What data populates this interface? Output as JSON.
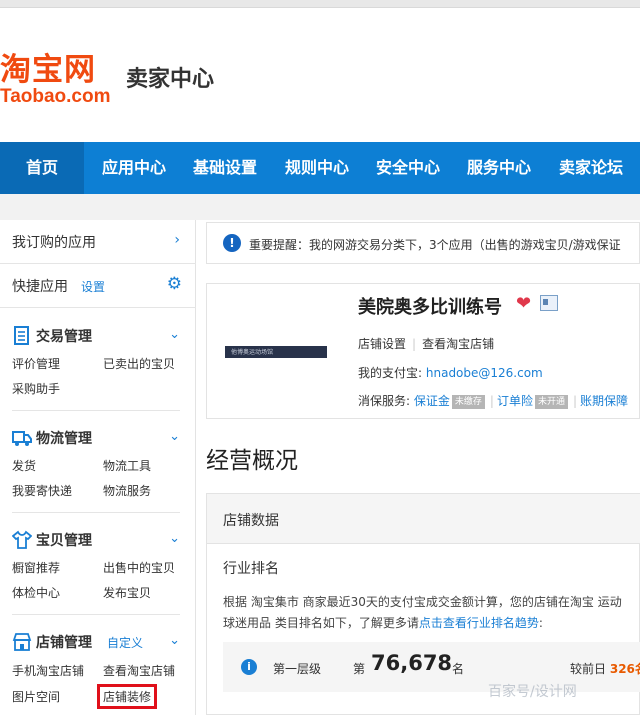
{
  "header": {
    "logo_cn": "淘宝网",
    "logo_en": "Taobao.com",
    "title": "卖家中心"
  },
  "nav": {
    "items": [
      {
        "label": "首页",
        "active": true
      },
      {
        "label": "应用中心"
      },
      {
        "label": "基础设置"
      },
      {
        "label": "规则中心"
      },
      {
        "label": "安全中心"
      },
      {
        "label": "服务中心"
      },
      {
        "label": "卖家论坛"
      }
    ]
  },
  "sidebar": {
    "subscribed": "我订购的应用",
    "quick": "快捷应用",
    "quick_setting": "设置",
    "sections": [
      {
        "title": "交易管理",
        "items": [
          "评价管理",
          "已卖出的宝贝",
          "采购助手"
        ]
      },
      {
        "title": "物流管理",
        "items": [
          "发货",
          "物流工具",
          "我要寄快递",
          "物流服务"
        ]
      },
      {
        "title": "宝贝管理",
        "items": [
          "橱窗推荐",
          "出售中的宝贝",
          "体检中心",
          "发布宝贝"
        ]
      },
      {
        "title": "店铺管理",
        "extra": "自定义",
        "items": [
          "手机淘宝店铺",
          "查看淘宝店铺",
          "图片空间",
          "店铺装修"
        ]
      }
    ]
  },
  "notice": {
    "text": "重要提醒：我的网游交易分类下，3个应用（出售的游戏宝贝/游戏保证"
  },
  "shop": {
    "thumb_text": "他博奥运动场馆",
    "name": "美院奥多比训练号",
    "links": [
      "店铺设置",
      "查看淘宝店铺"
    ],
    "alipay_label": "我的支付宝:",
    "alipay": "hnadobe@126.com",
    "insurance_label": "消保服务:",
    "insurance": [
      {
        "label": "保证金",
        "tag": "未缴存"
      },
      {
        "label": "订单险",
        "tag": "未开通"
      },
      {
        "label": "账期保障"
      }
    ]
  },
  "overview": {
    "title": "经营概况",
    "panel_title": "店铺数据",
    "rank_title": "行业排名",
    "desc_1": "根据 淘宝集市 商家最近30天的支付宝成交金额计算，您的店铺在淘宝 运动",
    "desc_2a": "球迷用品 类目排名如下，了解更多请",
    "desc_2_link": "点击查看行业排名趋势",
    "desc_2b": ":",
    "tier": {
      "label": "第一层级",
      "prefix": "第",
      "number": "76,678",
      "suffix": "名",
      "compare_label": "较前日",
      "compare_value": "326名"
    }
  },
  "watermark": "百家号/设计网",
  "colors": {
    "brand": "#f04a10",
    "nav": "#0d7fd4",
    "link": "#1a7fd4",
    "highlight": "#e0101a"
  }
}
